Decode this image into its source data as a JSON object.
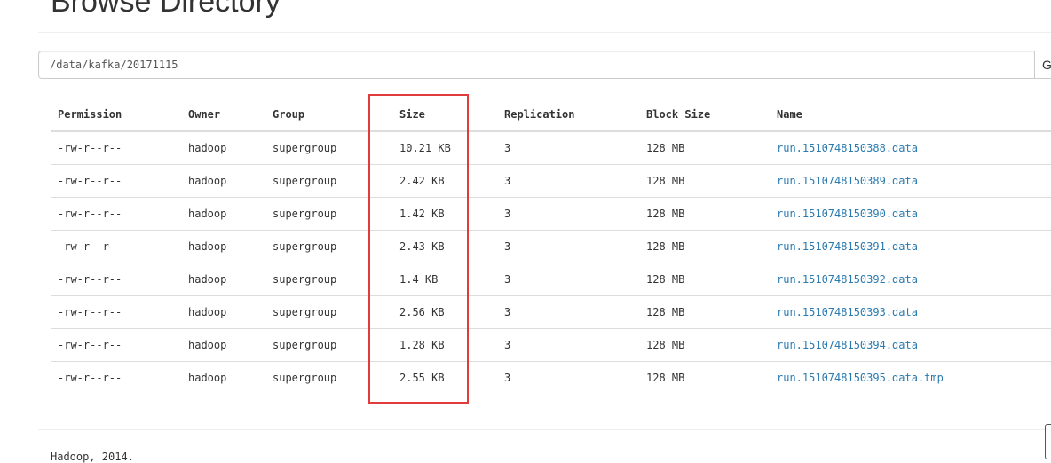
{
  "page": {
    "title": "Browse Directory"
  },
  "path_form": {
    "value": "/data/kafka/20171115",
    "go_label": "Go!"
  },
  "table": {
    "columns": [
      "Permission",
      "Owner",
      "Group",
      "Size",
      "Replication",
      "Block Size",
      "Name"
    ],
    "rows": [
      {
        "permission": "-rw-r--r--",
        "owner": "hadoop",
        "group": "supergroup",
        "size": "10.21 KB",
        "replication": "3",
        "block_size": "128 MB",
        "name": "run.1510748150388.data"
      },
      {
        "permission": "-rw-r--r--",
        "owner": "hadoop",
        "group": "supergroup",
        "size": "2.42 KB",
        "replication": "3",
        "block_size": "128 MB",
        "name": "run.1510748150389.data"
      },
      {
        "permission": "-rw-r--r--",
        "owner": "hadoop",
        "group": "supergroup",
        "size": "1.42 KB",
        "replication": "3",
        "block_size": "128 MB",
        "name": "run.1510748150390.data"
      },
      {
        "permission": "-rw-r--r--",
        "owner": "hadoop",
        "group": "supergroup",
        "size": "2.43 KB",
        "replication": "3",
        "block_size": "128 MB",
        "name": "run.1510748150391.data"
      },
      {
        "permission": "-rw-r--r--",
        "owner": "hadoop",
        "group": "supergroup",
        "size": "1.4 KB",
        "replication": "3",
        "block_size": "128 MB",
        "name": "run.1510748150392.data"
      },
      {
        "permission": "-rw-r--r--",
        "owner": "hadoop",
        "group": "supergroup",
        "size": "2.56 KB",
        "replication": "3",
        "block_size": "128 MB",
        "name": "run.1510748150393.data"
      },
      {
        "permission": "-rw-r--r--",
        "owner": "hadoop",
        "group": "supergroup",
        "size": "1.28 KB",
        "replication": "3",
        "block_size": "128 MB",
        "name": "run.1510748150394.data"
      },
      {
        "permission": "-rw-r--r--",
        "owner": "hadoop",
        "group": "supergroup",
        "size": "2.55 KB",
        "replication": "3",
        "block_size": "128 MB",
        "name": "run.1510748150395.data.tmp"
      }
    ]
  },
  "footer": {
    "text": "Hadoop, 2014."
  },
  "colors": {
    "link": "#2a7ab0",
    "highlight_border": "#e23b3b",
    "rule": "#dddddd"
  }
}
